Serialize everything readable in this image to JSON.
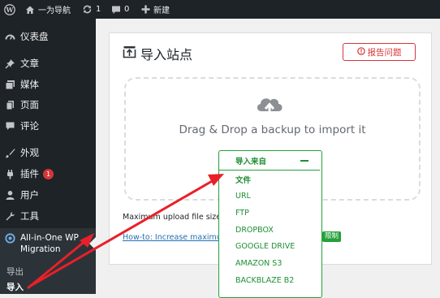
{
  "admin_bar": {
    "site_name": "一为导航",
    "updates_count": "1",
    "comments_count": "0",
    "new_label": "新建"
  },
  "sidebar": {
    "items": [
      {
        "label": "仪表盘"
      },
      {
        "label": "文章"
      },
      {
        "label": "媒体"
      },
      {
        "label": "页面"
      },
      {
        "label": "评论"
      },
      {
        "label": "外观"
      },
      {
        "label": "插件",
        "badge": "1"
      },
      {
        "label": "用户"
      },
      {
        "label": "工具"
      },
      {
        "label": "All-in-One WP Migration"
      }
    ],
    "submenu": [
      "导出",
      "导入"
    ]
  },
  "main": {
    "title": "导入站点",
    "report_button": "报告问题",
    "drop_text": "Drag & Drop a backup to import it",
    "max_upload_text": "Maximum upload file size:",
    "howto_text": "How-to: Increase maximum",
    "tag_text": "限制"
  },
  "import_dropdown": {
    "label": "导入来自",
    "options": [
      "文件",
      "URL",
      "FTP",
      "DROPBOX",
      "GOOGLE DRIVE",
      "AMAZON S3",
      "BACKBLAZE B2"
    ]
  },
  "colors": {
    "admin_dark": "#1d2327",
    "accent_green": "#23a03a",
    "report_red": "#d63638",
    "arrow_red": "#e8202a",
    "link_blue": "#2271b1"
  }
}
